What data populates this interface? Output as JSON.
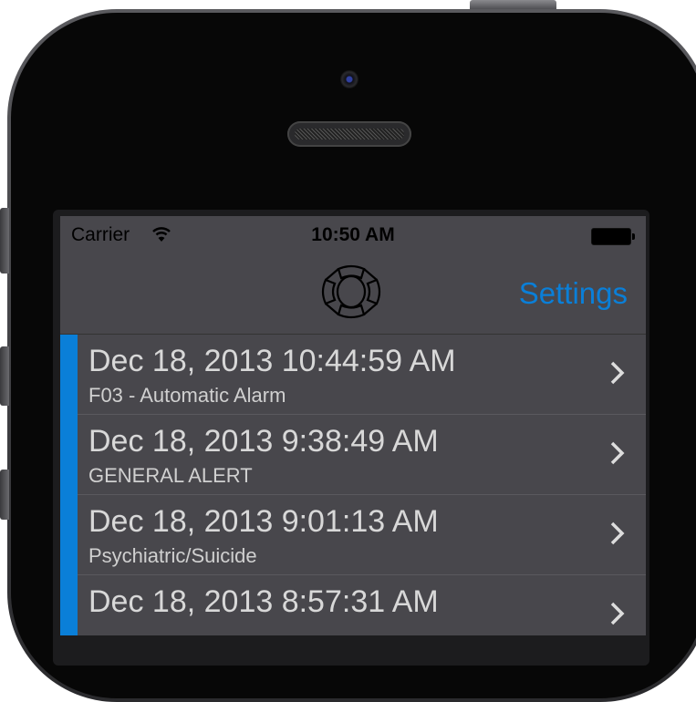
{
  "status_bar": {
    "carrier": "Carrier",
    "time": "10:50 AM",
    "wifi_icon": "wifi-icon",
    "battery_icon": "battery-icon"
  },
  "nav": {
    "logo_icon": "maltese-cross-icon",
    "settings_label": "Settings"
  },
  "colors": {
    "accent": "#0a7fd8",
    "background": "#48474c"
  },
  "alerts": [
    {
      "datetime": "Dec 18, 2013 10:44:59 AM",
      "type": "F03 - Automatic Alarm"
    },
    {
      "datetime": "Dec 18, 2013 9:38:49 AM",
      "type": "GENERAL ALERT"
    },
    {
      "datetime": "Dec 18, 2013 9:01:13 AM",
      "type": "Psychiatric/Suicide"
    },
    {
      "datetime": "Dec 18, 2013 8:57:31 AM",
      "type": ""
    }
  ]
}
